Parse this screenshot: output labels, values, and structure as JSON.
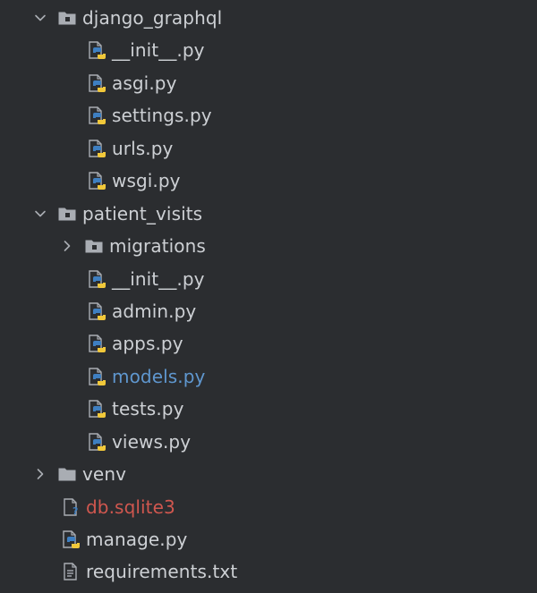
{
  "tree": {
    "items": [
      {
        "label": "django_graphql",
        "icon": "folder-package-icon",
        "expanded": true,
        "depth": 0
      },
      {
        "label": "__init__.py",
        "icon": "python-file-icon",
        "depth": 1
      },
      {
        "label": "asgi.py",
        "icon": "python-file-icon",
        "depth": 1
      },
      {
        "label": "settings.py",
        "icon": "python-file-icon",
        "depth": 1
      },
      {
        "label": "urls.py",
        "icon": "python-file-icon",
        "depth": 1
      },
      {
        "label": "wsgi.py",
        "icon": "python-file-icon",
        "depth": 1
      },
      {
        "label": "patient_visits",
        "icon": "folder-package-icon",
        "expanded": true,
        "depth": 0
      },
      {
        "label": "migrations",
        "icon": "folder-package-icon",
        "expanded": false,
        "depth": 1
      },
      {
        "label": "__init__.py",
        "icon": "python-file-icon",
        "depth": 1
      },
      {
        "label": "admin.py",
        "icon": "python-file-icon",
        "depth": 1
      },
      {
        "label": "apps.py",
        "icon": "python-file-icon",
        "depth": 1
      },
      {
        "label": "models.py",
        "icon": "python-file-icon",
        "depth": 1,
        "status": "modified"
      },
      {
        "label": "tests.py",
        "icon": "python-file-icon",
        "depth": 1
      },
      {
        "label": "views.py",
        "icon": "python-file-icon",
        "depth": 1
      },
      {
        "label": "venv",
        "icon": "folder-icon",
        "expanded": false,
        "depth": 0
      },
      {
        "label": "db.sqlite3",
        "icon": "unknown-file-icon",
        "depth": 0,
        "status": "unversioned"
      },
      {
        "label": "manage.py",
        "icon": "python-file-icon",
        "depth": 0
      },
      {
        "label": "requirements.txt",
        "icon": "text-file-icon",
        "depth": 0
      }
    ]
  },
  "colors": {
    "background": "#2b2d30",
    "text": "#cdd0d4",
    "modified": "#5f97cf",
    "unversioned": "#d0574f",
    "folder": "#a9adb3",
    "python_blue": "#3e7fc1",
    "python_yellow": "#f1c83a"
  }
}
